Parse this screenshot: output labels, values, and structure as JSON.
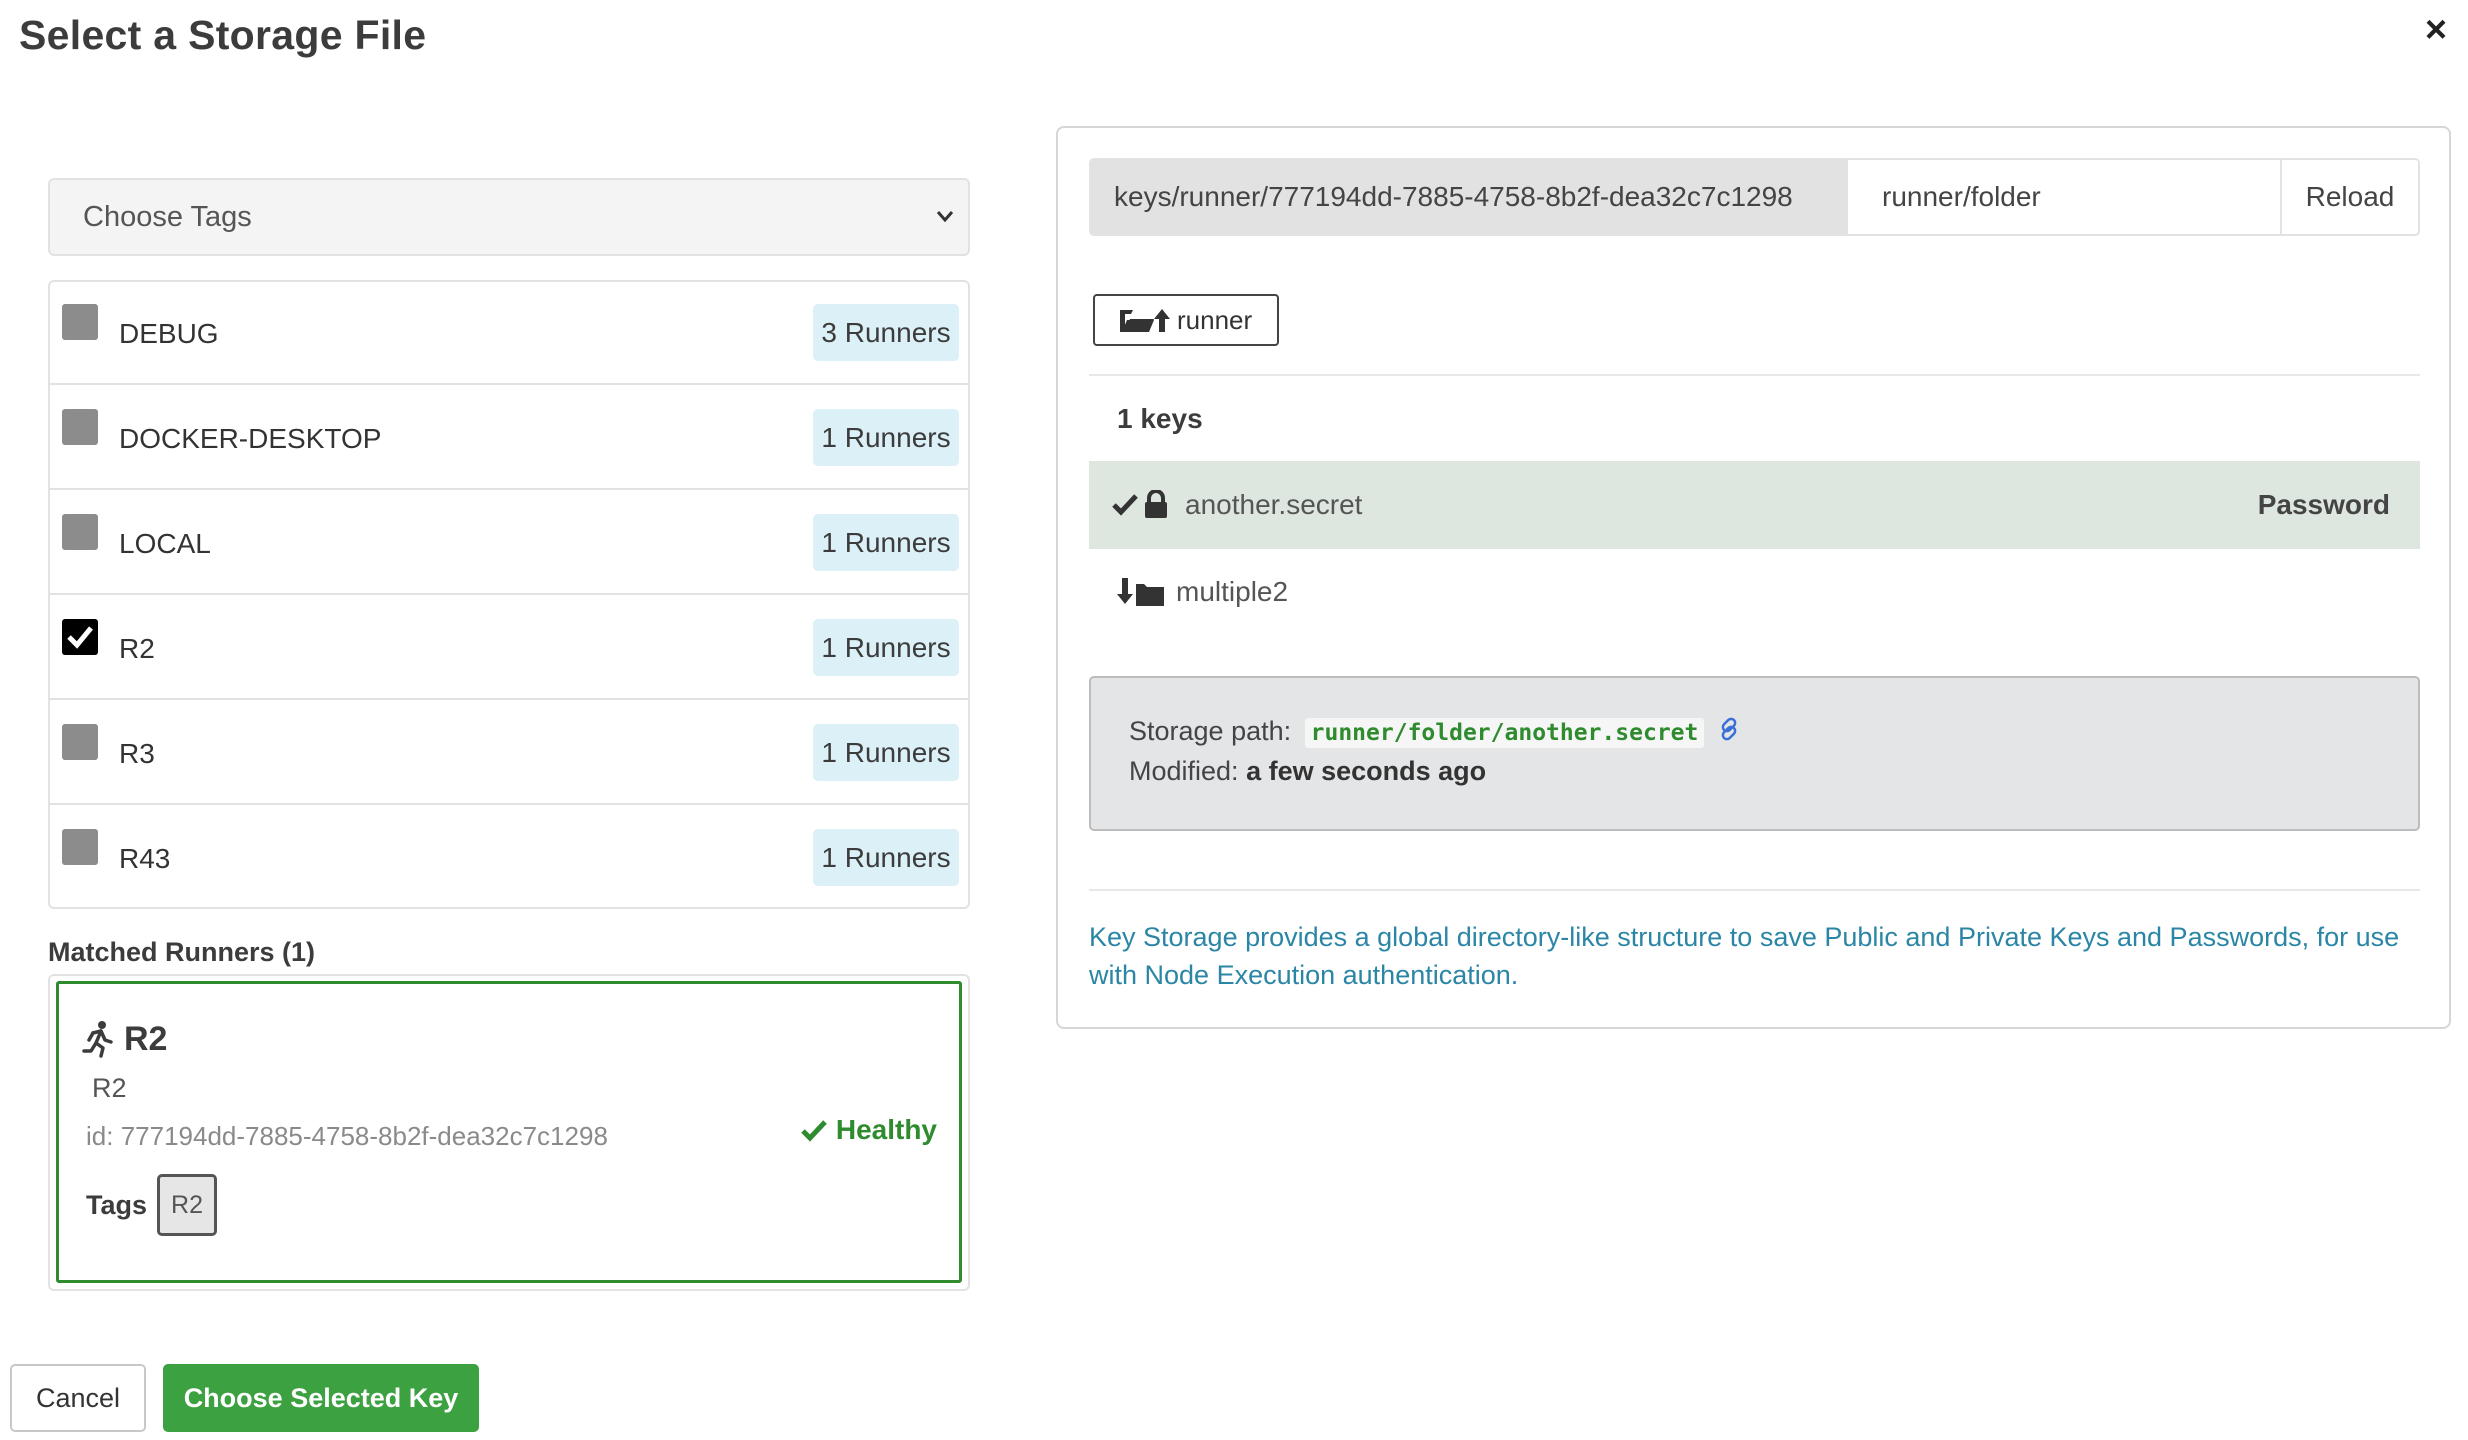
{
  "dialog": {
    "title": "Select a Storage File",
    "close_label": "×"
  },
  "tags": {
    "select_placeholder": "Choose Tags",
    "items": [
      {
        "name": "DEBUG",
        "badge": "3 Runners",
        "checked": false
      },
      {
        "name": "DOCKER-DESKTOP",
        "badge": "1 Runners",
        "checked": false
      },
      {
        "name": "LOCAL",
        "badge": "1 Runners",
        "checked": false
      },
      {
        "name": "R2",
        "badge": "1 Runners",
        "checked": true
      },
      {
        "name": "R3",
        "badge": "1 Runners",
        "checked": false
      },
      {
        "name": "R43",
        "badge": "1 Runners",
        "checked": false
      }
    ]
  },
  "matched": {
    "title": "Matched Runners (1)",
    "runner": {
      "name": "R2",
      "description": "R2",
      "id_label": "id:",
      "id": "777194dd-7885-4758-8b2f-dea32c7c1298",
      "status": "Healthy",
      "tags_label": "Tags",
      "tags": [
        "R2"
      ]
    }
  },
  "footer": {
    "cancel_label": "Cancel",
    "choose_label": "Choose Selected Key"
  },
  "storage": {
    "path_prefix": "keys/runner/777194dd-7885-4758-8b2f-dea32c7c1298",
    "path_value": "runner/folder",
    "reload_label": "Reload",
    "up_label": "runner",
    "keys_count": "1  keys",
    "selected_key": {
      "name": "another.secret",
      "type": "Password"
    },
    "folder": {
      "name": "multiple2"
    },
    "detail": {
      "path_label": "Storage path:",
      "path_value": "runner/folder/another.secret",
      "modified_label": "Modified:",
      "modified_value": "a few seconds ago"
    },
    "info": "Key Storage provides a global directory-like structure to save Public and Private Keys and Passwords, for use with Node Execution authentication."
  },
  "colors": {
    "accent_green": "#3ca140",
    "healthy_green": "#2e8b2e",
    "info_blue": "#2b86a5",
    "badge_bg": "#dcf0f7",
    "selected_row_bg": "#dde6df"
  }
}
